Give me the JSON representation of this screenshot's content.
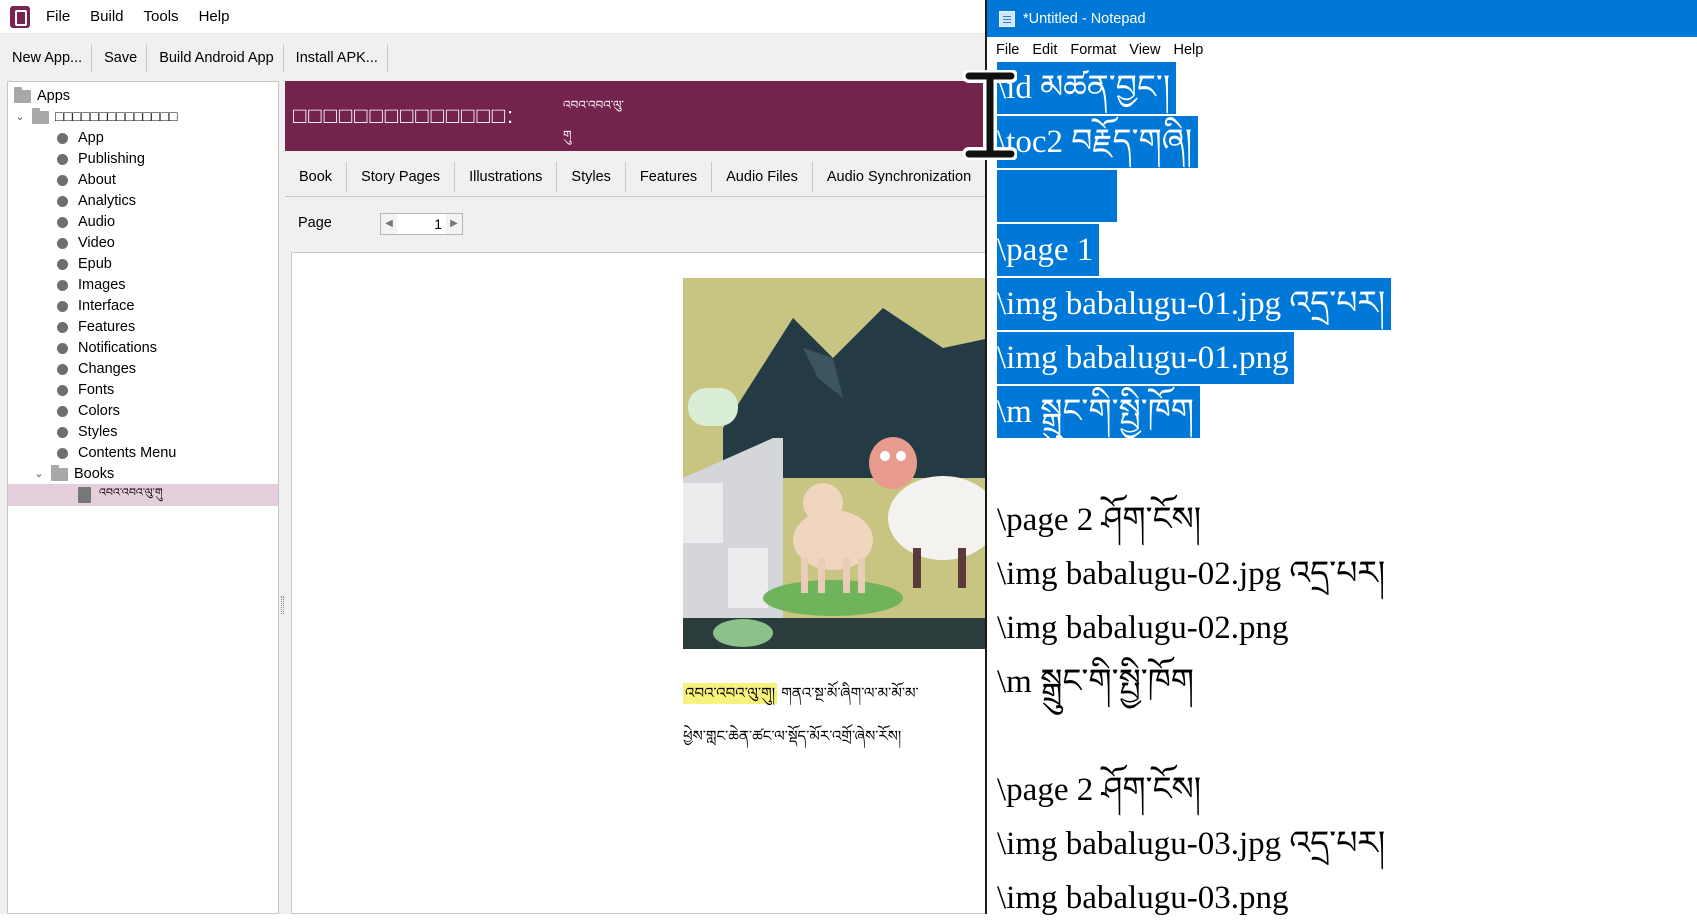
{
  "menubar": {
    "items": [
      "File",
      "Build",
      "Tools",
      "Help"
    ]
  },
  "toolbar": {
    "items": [
      "New App...",
      "Save",
      "Build Android App",
      "Install APK..."
    ]
  },
  "tree": {
    "root": "Apps",
    "app_name": "□□□□□□□□□□□□□□",
    "items": [
      "App",
      "Publishing",
      "About",
      "Analytics",
      "Audio",
      "Video",
      "Epub",
      "Images",
      "Interface",
      "Features",
      "Notifications",
      "Changes",
      "Fonts",
      "Colors",
      "Styles",
      "Contents Menu"
    ],
    "books_folder": "Books",
    "book_item": "འབའ་འབའ་ལུ་གུ"
  },
  "book_header": {
    "title": "□□□□□□□□□□□□□□:",
    "subtitle_line1": "འབའ་འབའ་ལུ་",
    "subtitle_line2": "གུ",
    "header_color": "#74244c"
  },
  "tabs": [
    "Book",
    "Story Pages",
    "Illustrations",
    "Styles",
    "Features",
    "Audio Files",
    "Audio Synchronization"
  ],
  "page_nav": {
    "label": "Page",
    "value": "1"
  },
  "story": {
    "highlight": "འབའ་འབའ་ལུ་གུ།",
    "line1_rest": " གནའ་སྔ་མོ་ཞིག་ལ་མ་མོ་མ་",
    "line2": "ཕྱེས་གླང་ཆེན་ཚང་ལ་སྡོད་མོར་འགྲོ་ཞེས་ཪོས།",
    "highlight_color": "#f7f27b"
  },
  "notepad": {
    "title": "*Untitled - Notepad",
    "menu": [
      "File",
      "Edit",
      "Format",
      "View",
      "Help"
    ],
    "lines": [
      {
        "text": "\\id མཚན་བྱང་།",
        "selected": true
      },
      {
        "text": "\\toc2 བརྗོད་གཞི།",
        "selected": true
      },
      {
        "text": "",
        "selected": true
      },
      {
        "text": "\\page 1",
        "selected": true
      },
      {
        "text": "\\img babalugu-01.jpg འདྲ་པར།",
        "selected": true
      },
      {
        "text": "\\img babalugu-01.png",
        "selected": true
      },
      {
        "text": "\\m སྒྲུང་གི་སྤྱི་ཁོག",
        "selected": true
      },
      {
        "text": "",
        "selected": false
      },
      {
        "text": "\\page 2 ཤོག་ངོས།",
        "selected": false
      },
      {
        "text": "\\img babalugu-02.jpg འདྲ་པར།",
        "selected": false
      },
      {
        "text": "\\img babalugu-02.png",
        "selected": false
      },
      {
        "text": "\\m སྒྲུང་གི་སྤྱི་ཁོག",
        "selected": false
      },
      {
        "text": "",
        "selected": false
      },
      {
        "text": "\\page 2 ཤོག་ངོས།",
        "selected": false
      },
      {
        "text": "\\img babalugu-03.jpg འདྲ་པར།",
        "selected": false
      },
      {
        "text": "\\img babalugu-03.png",
        "selected": false
      }
    ],
    "accent_color": "#0078d7"
  }
}
